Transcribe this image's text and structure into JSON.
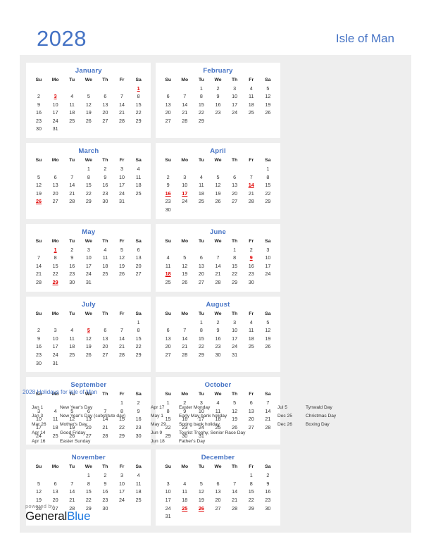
{
  "header": {
    "year": "2028",
    "country": "Isle of Man",
    "accent_color": "#4472c4",
    "holiday_color": "#e00000"
  },
  "weekday_headers": [
    "Su",
    "Mo",
    "Tu",
    "We",
    "Th",
    "Fr",
    "Sa"
  ],
  "months": [
    {
      "name": "January",
      "lead_blanks": 6,
      "days": 31,
      "holidays": [
        1,
        3
      ]
    },
    {
      "name": "February",
      "lead_blanks": 2,
      "days": 29,
      "holidays": []
    },
    {
      "name": "March",
      "lead_blanks": 3,
      "days": 31,
      "holidays": [
        26
      ]
    },
    {
      "name": "April",
      "lead_blanks": 6,
      "days": 30,
      "holidays": [
        14,
        16,
        17
      ]
    },
    {
      "name": "May",
      "lead_blanks": 1,
      "days": 31,
      "holidays": [
        1,
        29
      ]
    },
    {
      "name": "June",
      "lead_blanks": 4,
      "days": 30,
      "holidays": [
        9,
        18
      ]
    },
    {
      "name": "July",
      "lead_blanks": 6,
      "days": 31,
      "holidays": [
        5
      ]
    },
    {
      "name": "August",
      "lead_blanks": 2,
      "days": 31,
      "holidays": []
    },
    {
      "name": "September",
      "lead_blanks": 5,
      "days": 30,
      "holidays": []
    },
    {
      "name": "October",
      "lead_blanks": 0,
      "days": 31,
      "holidays": []
    },
    {
      "name": "November",
      "lead_blanks": 3,
      "days": 30,
      "holidays": []
    },
    {
      "name": "December",
      "lead_blanks": 5,
      "days": 31,
      "holidays": [
        25,
        26
      ]
    }
  ],
  "legend": {
    "title": "2028 Holidays for Isle of Man",
    "columns": [
      [
        {
          "date": "Jan 1",
          "name": "New Year's Day"
        },
        {
          "date": "Jan 3",
          "name": "New Year's Day (substitute day)"
        },
        {
          "date": "Mar 26",
          "name": "Mother's Day"
        },
        {
          "date": "Apr 14",
          "name": "Good Friday"
        },
        {
          "date": "Apr 16",
          "name": "Easter Sunday"
        }
      ],
      [
        {
          "date": "Apr 17",
          "name": "Easter Monday"
        },
        {
          "date": "May 1",
          "name": "Early May bank holiday"
        },
        {
          "date": "May 29",
          "name": "Spring bank holiday"
        },
        {
          "date": "Jun 9",
          "name": "Tourist Trophy, Senior Race Day"
        },
        {
          "date": "Jun 18",
          "name": "Father's Day"
        }
      ],
      [
        {
          "date": "Jul 5",
          "name": "Tynwald Day"
        },
        {
          "date": "Dec 25",
          "name": "Christmas Day"
        },
        {
          "date": "Dec 26",
          "name": "Boxing Day"
        }
      ]
    ]
  },
  "footer": {
    "powered_by": "powered by",
    "brand_first": "General",
    "brand_second": "Blue"
  }
}
